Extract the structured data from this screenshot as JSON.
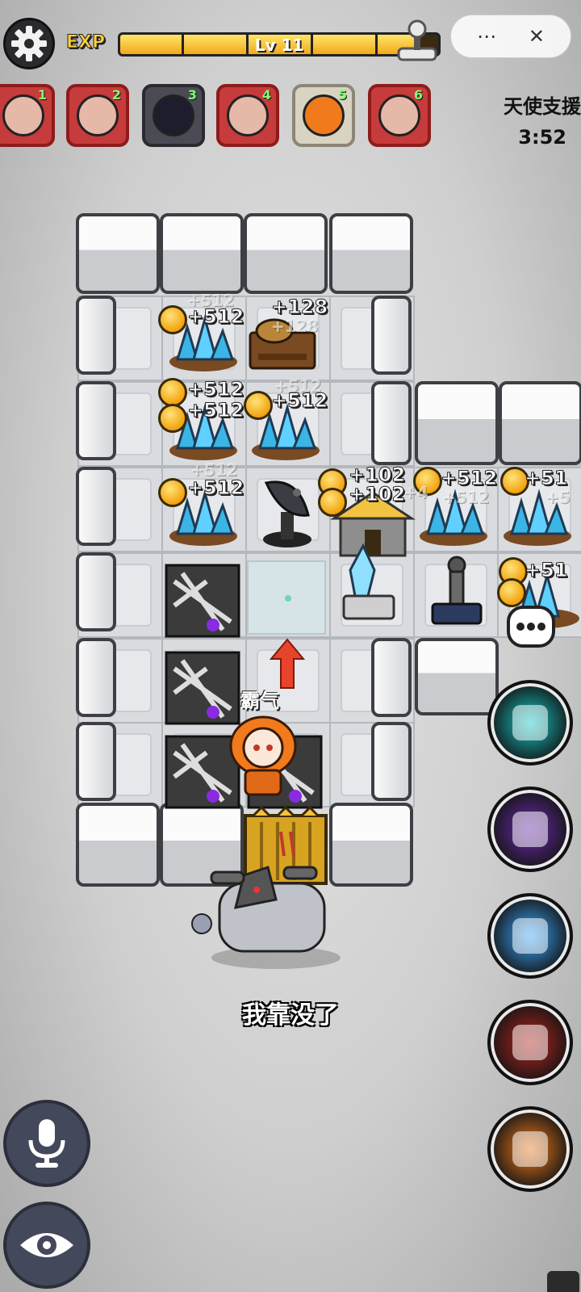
{
  "hud": {
    "exp_label": "EXP",
    "level": "Lv 11",
    "exp_progress": 0.93
  },
  "units": [
    {
      "num": "1",
      "style": "red"
    },
    {
      "num": "2",
      "style": "red"
    },
    {
      "num": "3",
      "style": "dark"
    },
    {
      "num": "4",
      "style": "red"
    },
    {
      "num": "5",
      "style": "light"
    },
    {
      "num": "6",
      "style": "red"
    }
  ],
  "side_event": {
    "label": "天使支援",
    "timer": "3:52"
  },
  "board": {
    "gold_labels": [
      "+512",
      "+128",
      "+512",
      "+512",
      "+512",
      "+512",
      "+102",
      "+102",
      "+512",
      "+51",
      "+51"
    ],
    "ghost_labels": [
      "+512",
      "+128",
      "+512",
      "+512",
      "+4",
      "+512",
      "+5"
    ],
    "buff_label": "霸气"
  },
  "subtitle": "我靠没了",
  "skills": [
    {
      "icon": "shield-skill-icon",
      "color": "#13c7c7"
    },
    {
      "icon": "shadow-beast-skill-icon",
      "color": "#6b2bb0"
    },
    {
      "icon": "ice-burst-skill-icon",
      "color": "#3aa7ff"
    },
    {
      "icon": "rage-face-skill-icon",
      "color": "#b8251d"
    },
    {
      "icon": "rocket-skill-icon",
      "color": "#f07a1c"
    }
  ],
  "colors": {
    "exp_fill": "#f0a91c",
    "unit_red": "#c63b3b",
    "unit_number": "#7dff70"
  }
}
